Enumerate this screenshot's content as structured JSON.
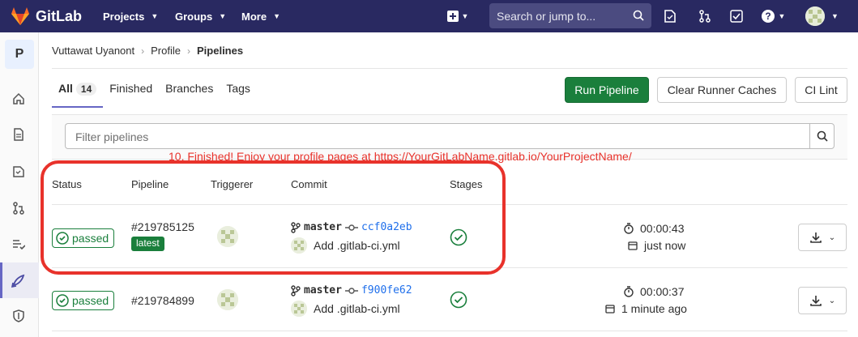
{
  "navbar": {
    "brand": "GitLab",
    "menus": [
      {
        "label": "Projects"
      },
      {
        "label": "Groups"
      },
      {
        "label": "More"
      }
    ],
    "search_placeholder": "Search or jump to...",
    "icons": [
      "plus-icon",
      "search-icon",
      "todo-icon",
      "merge-request-icon",
      "issues-check-icon",
      "help-icon",
      "avatar"
    ]
  },
  "sidebar": {
    "project_initial": "P",
    "items": [
      "home-icon",
      "repository-icon",
      "issues-icon",
      "merge-request-icon",
      "ci-cd-icon",
      "rocket-icon",
      "shield-icon"
    ]
  },
  "breadcrumb": {
    "items": [
      "Vuttawat Uyanont",
      "Profile",
      "Pipelines"
    ]
  },
  "tabs": [
    {
      "label": "All",
      "count": "14"
    },
    {
      "label": "Finished"
    },
    {
      "label": "Branches"
    },
    {
      "label": "Tags"
    }
  ],
  "actions": {
    "run_pipeline": "Run Pipeline",
    "clear_caches": "Clear Runner Caches",
    "ci_lint": "CI Lint"
  },
  "filter": {
    "placeholder": "Filter pipelines"
  },
  "annotation": "10. Finished! Enjoy your profile pages at https://YourGitLabName.gitlab.io/YourProjectName/",
  "table": {
    "headers": [
      "Status",
      "Pipeline",
      "Triggerer",
      "Commit",
      "Stages"
    ],
    "rows": [
      {
        "status": "passed",
        "pipeline": "#219785125",
        "tag": "latest",
        "branch": "master",
        "sha": "ccf0a2eb",
        "message": "Add .gitlab-ci.yml",
        "duration": "00:00:43",
        "finished": "just now"
      },
      {
        "status": "passed",
        "pipeline": "#219784899",
        "branch": "master",
        "sha": "f900fe62",
        "message": "Add .gitlab-ci.yml",
        "duration": "00:00:37",
        "finished": "1 minute ago"
      }
    ]
  },
  "colors": {
    "navbar": "#292961",
    "success": "#1a7f3c",
    "annotation": "#e8322b",
    "link": "#1f6feb"
  }
}
